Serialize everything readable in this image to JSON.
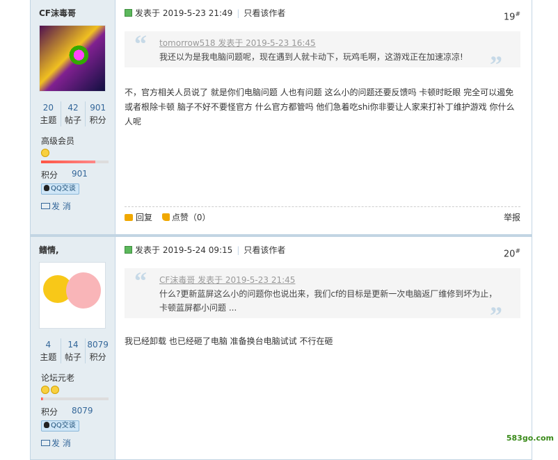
{
  "posts": [
    {
      "author": "CF沫毒哥",
      "stats": [
        {
          "value": "20",
          "label": "主题"
        },
        {
          "value": "42",
          "label": "帖子"
        },
        {
          "value": "901",
          "label": "积分"
        }
      ],
      "group": "高级会员",
      "level_fraction": 0.8,
      "points_label": "积分",
      "points_value": "901",
      "qq_label": "QQ交谈",
      "message_label": "发 消",
      "posted": "发表于 2019-5-23 21:49",
      "author_only": "只看该作者",
      "floor": "19",
      "floor_mark": "#",
      "quote_meta": "tomorrow518 发表于 2019-5-23 16:45",
      "quote_text": "我还以为是我电脑问题呢，现在遇到人就卡动下，玩鸡毛啊，这游戏正在加速凉凉!",
      "content": "不，官方相关人员说了 就是你们电脑问题 人也有问题 这么小的问题还要反馈吗 卡顿时眨眼 完全可以遏免或者根除卡顿 脑子不好不要怪官方 什么官方都管吗 他们急着吃shi你非要让人家来打补丁维护游戏 你什么人呢",
      "reply_label": "回复",
      "like_label": "点赞（0）",
      "report_label": "举报"
    },
    {
      "author": "鳍情,",
      "stats": [
        {
          "value": "4",
          "label": "主题"
        },
        {
          "value": "14",
          "label": "帖子"
        },
        {
          "value": "8079",
          "label": "积分"
        }
      ],
      "group": "论坛元老",
      "level_fraction": 0.03,
      "points_label": "积分",
      "points_value": "8079",
      "qq_label": "QQ交谈",
      "message_label": "发 消",
      "posted": "发表于 2019-5-24 09:15",
      "author_only": "只看该作者",
      "floor": "20",
      "floor_mark": "#",
      "quote_meta": "CF沫毒哥 发表于 2019-5-23 21:45",
      "quote_text": "什么?更新蓝屏这么小的问题你也说出来，我们cf的目标是更新一次电脑返厂维修到坏为止，卡顿蓝屏都小问题 ...",
      "content": "我已经卸载 也已经砸了电脑 准备换台电脑试试 不行在砸"
    }
  ],
  "watermark": "583go.com"
}
